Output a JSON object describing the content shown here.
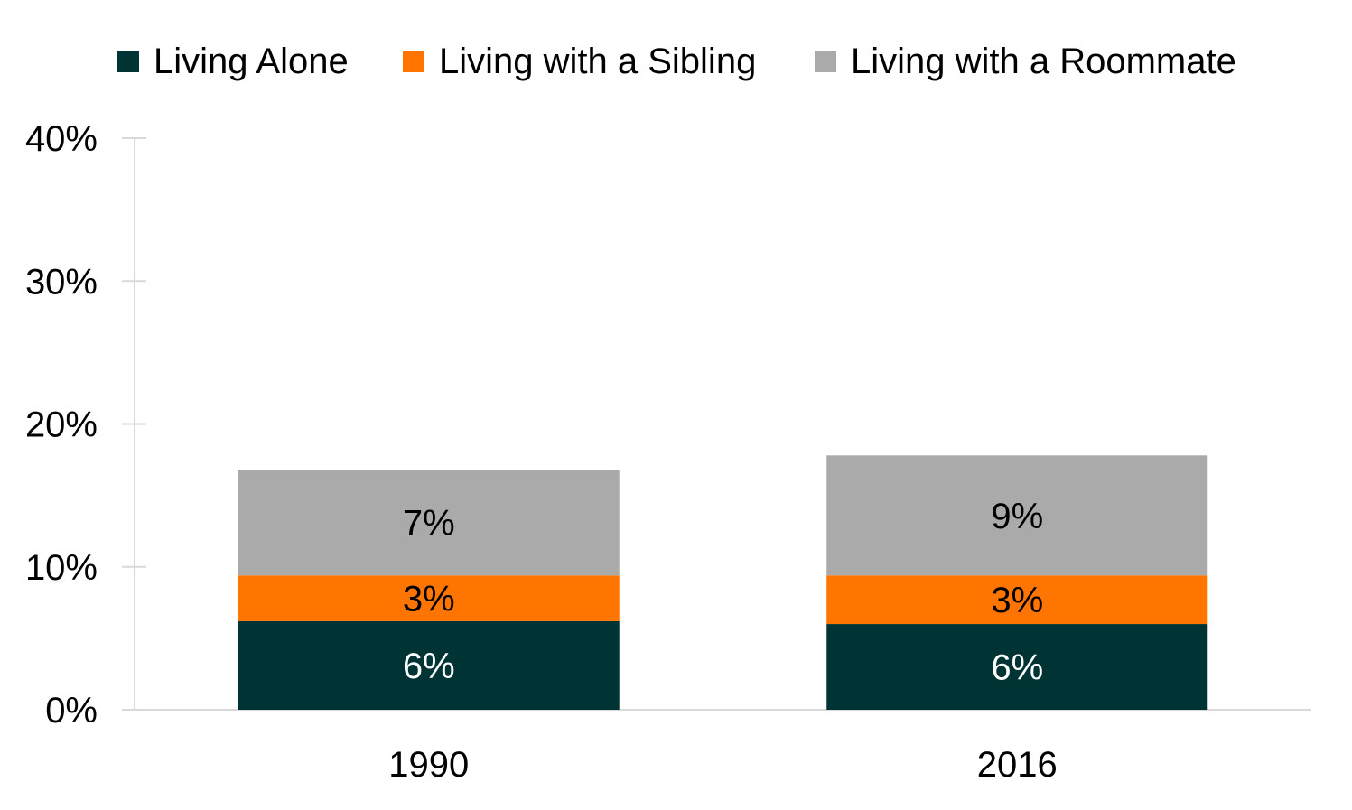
{
  "chart_data": {
    "type": "bar",
    "stacked": true,
    "title": "",
    "xlabel": "",
    "ylabel": "",
    "categories": [
      "1990",
      "2016"
    ],
    "series": [
      {
        "name": "Living Alone",
        "color": "#003333",
        "values": [
          6.2,
          6.0
        ],
        "labels": [
          "6%",
          "6%"
        ],
        "label_color": "#ffffff"
      },
      {
        "name": "Living with a Sibling",
        "color": "#FF7500",
        "values": [
          3.2,
          3.4
        ],
        "labels": [
          "3%",
          "3%"
        ],
        "label_color": "#000000"
      },
      {
        "name": "Living with a Roommate",
        "color": "#AAAAAA",
        "values": [
          7.4,
          8.4
        ],
        "labels": [
          "7%",
          "9%"
        ],
        "label_color": "#000000"
      }
    ],
    "ylim": [
      0,
      40
    ],
    "yticks": [
      0,
      10,
      20,
      30,
      40
    ],
    "ytick_labels": [
      "0%",
      "10%",
      "20%",
      "30%",
      "40%"
    ],
    "grid": false,
    "legend_position": "top"
  }
}
